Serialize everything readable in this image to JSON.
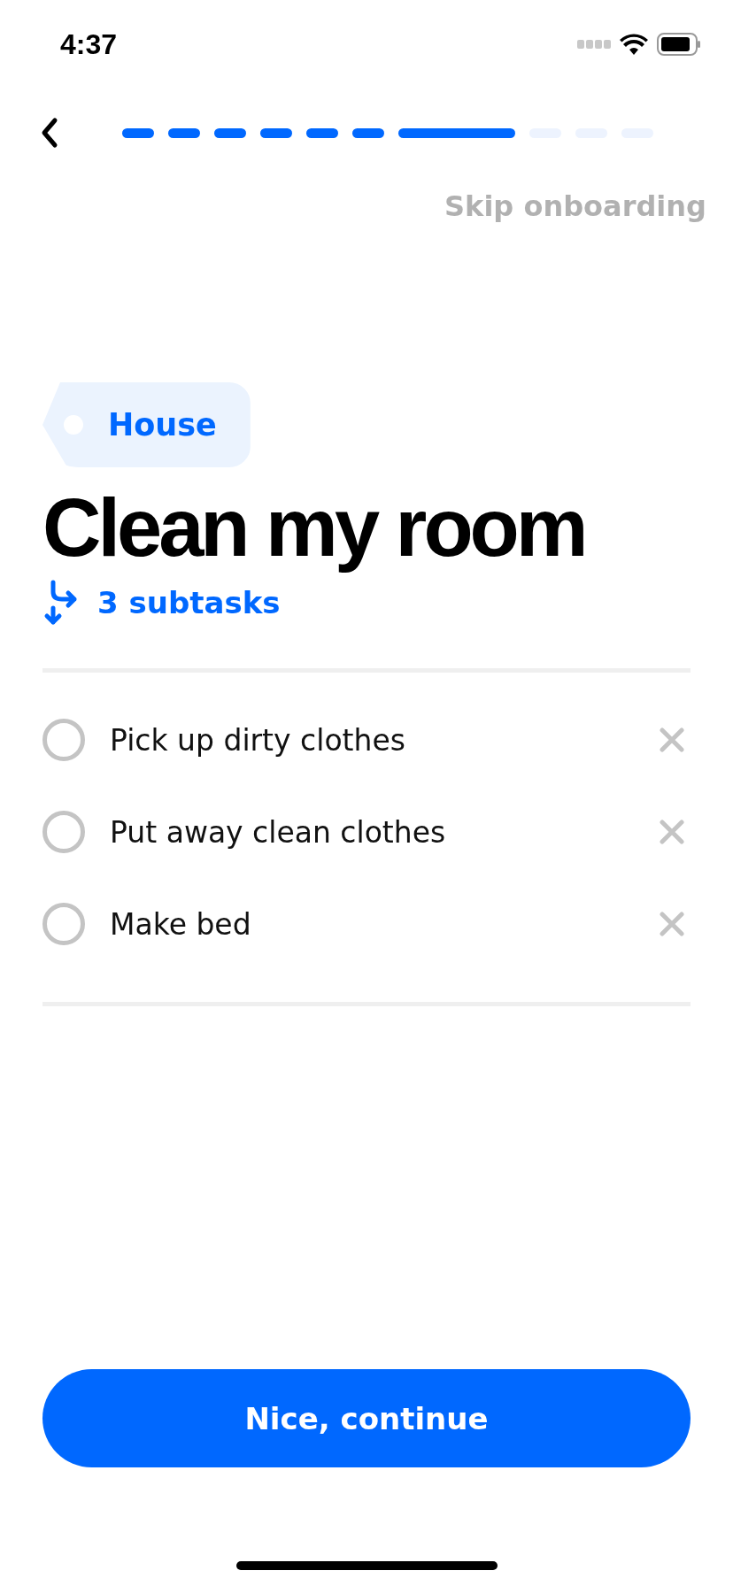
{
  "status_bar": {
    "time": "4:37"
  },
  "progress": [
    {
      "kind": "short",
      "filled": true
    },
    {
      "kind": "short",
      "filled": true
    },
    {
      "kind": "short",
      "filled": true
    },
    {
      "kind": "short",
      "filled": true
    },
    {
      "kind": "short",
      "filled": true
    },
    {
      "kind": "short",
      "filled": true
    },
    {
      "kind": "long",
      "filled": true
    },
    {
      "kind": "short",
      "filled": false
    },
    {
      "kind": "short",
      "filled": false
    },
    {
      "kind": "short",
      "filled": false
    }
  ],
  "skip_link": "Skip onboarding",
  "tag": {
    "label": "House"
  },
  "title": "Clean my room",
  "subtask_count": "3 subtasks",
  "subtasks": [
    {
      "label": "Pick up dirty clothes",
      "checked": false
    },
    {
      "label": "Put away clean clothes",
      "checked": false
    },
    {
      "label": "Make bed",
      "checked": false
    }
  ],
  "continue_button": "Nice, continue"
}
